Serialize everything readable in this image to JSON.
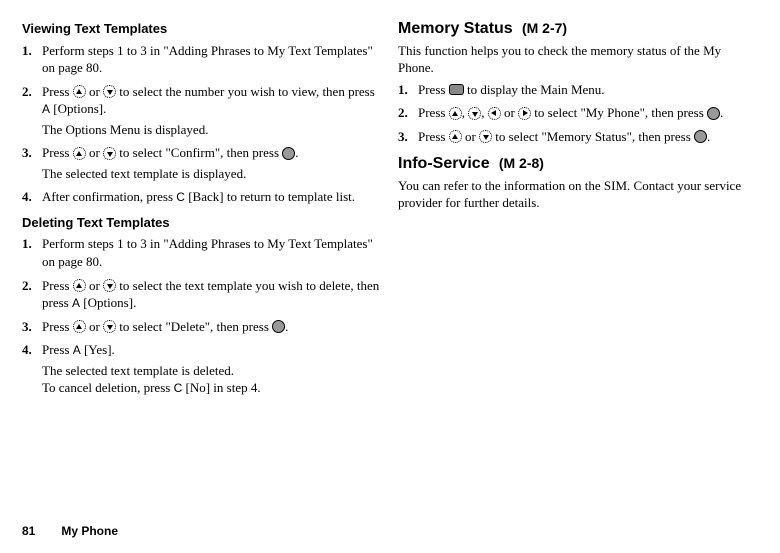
{
  "left": {
    "viewing": {
      "title": "Viewing Text Templates",
      "steps": [
        {
          "num": "1.",
          "text": "Perform steps 1 to 3 in \"Adding Phrases to My Text Templates\" on page 80."
        },
        {
          "num": "2.",
          "pre": "Press ",
          "or": " or ",
          "post1": " to select the number you wish to view, then press ",
          "key1": "A",
          "post2": " [Options].",
          "followup": "The Options Menu is displayed."
        },
        {
          "num": "3.",
          "pre": "Press ",
          "or": " or ",
          "post1": " to select \"Confirm\", then press ",
          "dot": ".",
          "followup": "The selected text template is displayed."
        },
        {
          "num": "4.",
          "pre": "After confirmation, press ",
          "key1": "C",
          "post1": " [Back] to return to template list."
        }
      ]
    },
    "deleting": {
      "title": "Deleting Text Templates",
      "steps": [
        {
          "num": "1.",
          "text": "Perform steps 1 to 3 in \"Adding Phrases to My Text Templates\" on page 80."
        },
        {
          "num": "2.",
          "pre": "Press ",
          "or": " or ",
          "post1": " to select the text template you wish to delete, then press ",
          "key1": "A",
          "post2": " [Options]."
        },
        {
          "num": "3.",
          "pre": "Press ",
          "or": " or ",
          "post1": " to select \"Delete\", then press ",
          "dot": "."
        },
        {
          "num": "4.",
          "pre": "Press ",
          "key1": "A",
          "post1": " [Yes].",
          "followup1": "The selected text template is deleted.",
          "followup2a": "To cancel deletion, press ",
          "key2": "C",
          "followup2b": " [No] in step 4."
        }
      ]
    }
  },
  "right": {
    "memory": {
      "title": "Memory Status",
      "mcode": "(M 2-7)",
      "intro": "This function helps you to check the memory status of the My Phone.",
      "steps": [
        {
          "num": "1.",
          "pre": "Press ",
          "post": " to display the Main Menu."
        },
        {
          "num": "2.",
          "pre": "Press ",
          "c1": ", ",
          "c2": ", ",
          "or": " or ",
          "post1": " to select \"My Phone\", then press ",
          "dot": "."
        },
        {
          "num": "3.",
          "pre": "Press ",
          "or": " or ",
          "post1": " to select \"Memory Status\", then press ",
          "dot": "."
        }
      ]
    },
    "info": {
      "title": "Info-Service",
      "mcode": "(M 2-8)",
      "intro": "You can refer to the information on the SIM. Contact your service provider for further details."
    }
  },
  "footer": {
    "page": "81",
    "section": "My Phone"
  }
}
